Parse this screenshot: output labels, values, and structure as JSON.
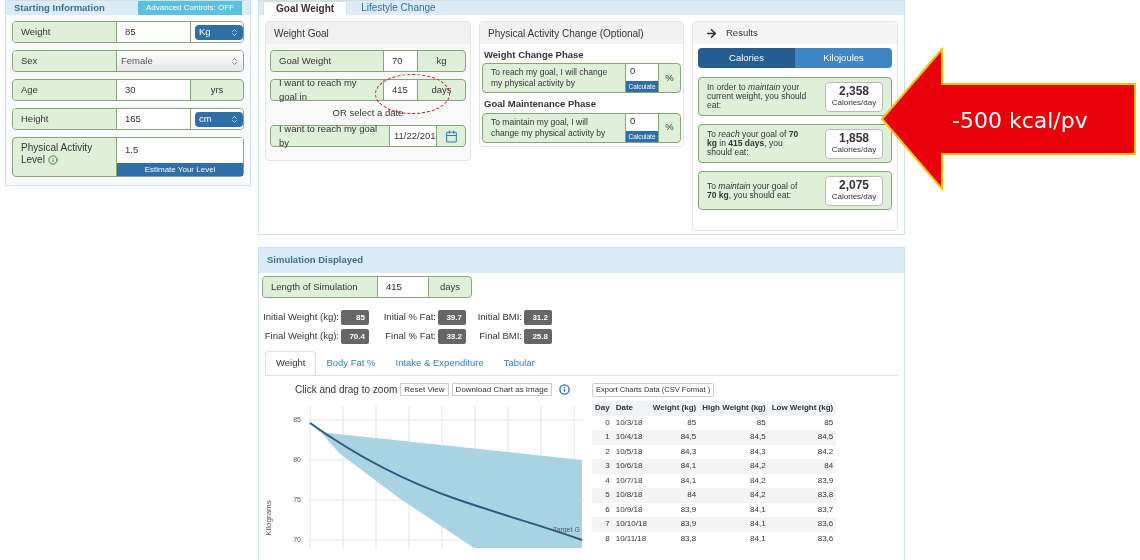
{
  "starting": {
    "title": "Starting Information",
    "advanced_button": "Advanced Controls: OFF",
    "fields": [
      {
        "kind": "select-unit",
        "label": "Weight",
        "value": "85",
        "unit": "Kg"
      },
      {
        "kind": "select",
        "label": "Sex",
        "value": "Female"
      },
      {
        "kind": "unit",
        "label": "Age",
        "value": "30",
        "unit": "yrs"
      },
      {
        "kind": "select-unit",
        "label": "Height",
        "value": "165",
        "unit": "cm"
      },
      {
        "kind": "estimate",
        "label": "Physical Activity Level",
        "value": "1.5",
        "button": "Estimate Your Level"
      }
    ]
  },
  "goal_tabs": [
    {
      "label": "Goal Weight",
      "selected": true
    },
    {
      "label": "Lifestyle Change",
      "selected": false
    }
  ],
  "weight_goal": {
    "title": "Weight Goal",
    "goal_weight": {
      "label": "Goal Weight",
      "value": "70",
      "unit": "kg"
    },
    "days": {
      "label": "I want to reach my goal in",
      "value": "415",
      "unit": "days",
      "circled": true
    },
    "or_text": "OR select a date",
    "date": {
      "label": "I want to reach my goal by",
      "value": "11/22/201"
    }
  },
  "activity": {
    "title": "Physical Activity Change (Optional)",
    "phases": [
      {
        "title": "Weight Change Phase",
        "label": "To reach my goal, I will change my physical activity by",
        "value": "0",
        "button": "Calculate",
        "unit": "%"
      },
      {
        "title": "Goal Maintenance Phase",
        "label": "To maintain my goal, I will change my physical activity by",
        "value": "0",
        "button": "Calculate",
        "unit": "%"
      }
    ]
  },
  "results": {
    "title": "Results",
    "unit_tabs": [
      {
        "label": "Calories",
        "selected": true
      },
      {
        "label": "Kilojoules",
        "selected": false
      }
    ],
    "cards": [
      {
        "text": "In order to *maintain* your current weight, you should eat:",
        "value": "2,358",
        "unit": "Calories/day"
      },
      {
        "text": "To *reach* your goal of **70 kg** in **415 days**, you should eat:",
        "value": "1,858",
        "unit": "Calories/day"
      },
      {
        "text": "To *maintain* your goal of **70 kg**, you should eat:",
        "value": "2,075",
        "unit": "Calories/day"
      }
    ]
  },
  "annotation": {
    "text": "-500 kcal/pv"
  },
  "simulation": {
    "title": "Simulation Displayed",
    "length": {
      "label": "Length of Simulation",
      "value": "415",
      "unit": "days"
    },
    "stats": [
      [
        {
          "label": "Initial Weight (kg):",
          "value": "85"
        },
        {
          "label": "Initial % Fat:",
          "value": "39.7"
        },
        {
          "label": "Initial BMI:",
          "value": "31.2"
        }
      ],
      [
        {
          "label": "Final Weight (kg):",
          "value": "70.4"
        },
        {
          "label": "Final % Fat:",
          "value": "33.2"
        },
        {
          "label": "Final BMI:",
          "value": "25.8"
        }
      ]
    ],
    "tabs": [
      {
        "label": "Weight",
        "selected": true
      },
      {
        "label": "Body Fat %",
        "selected": false
      },
      {
        "label": "Intake & Expenditure",
        "selected": false
      },
      {
        "label": "Tabular",
        "selected": false
      }
    ],
    "chart": {
      "hint": "Click and drag to zoom",
      "buttons": [
        "Reset View",
        "Download Chart as Image"
      ],
      "ylabel": "Kilograms",
      "yticks": [
        "85",
        "80",
        "75",
        "70"
      ],
      "line_label": "Target G"
    },
    "export_button": "Export Charts Data (CSV Format )",
    "table": {
      "columns": [
        "Day",
        "Date",
        "Weight (kg)",
        "High Weight (kg)",
        "Low Weight (kg)"
      ],
      "rows": [
        [
          "0",
          "10/3/18",
          "85",
          "85",
          "85"
        ],
        [
          "1",
          "10/4/18",
          "84,5",
          "84,5",
          "84,5"
        ],
        [
          "2",
          "10/5/18",
          "84,3",
          "84,3",
          "84,2"
        ],
        [
          "3",
          "10/6/18",
          "84,1",
          "84,2",
          "84"
        ],
        [
          "4",
          "10/7/18",
          "84,1",
          "84,2",
          "83,9"
        ],
        [
          "5",
          "10/8/18",
          "84",
          "84,2",
          "83,8"
        ],
        [
          "6",
          "10/9/18",
          "83,9",
          "84,1",
          "83,7"
        ],
        [
          "7",
          "10/10/18",
          "83,9",
          "84,1",
          "83,6"
        ],
        [
          "8",
          "10/11/18",
          "83,8",
          "84,1",
          "83,6"
        ]
      ]
    }
  }
}
